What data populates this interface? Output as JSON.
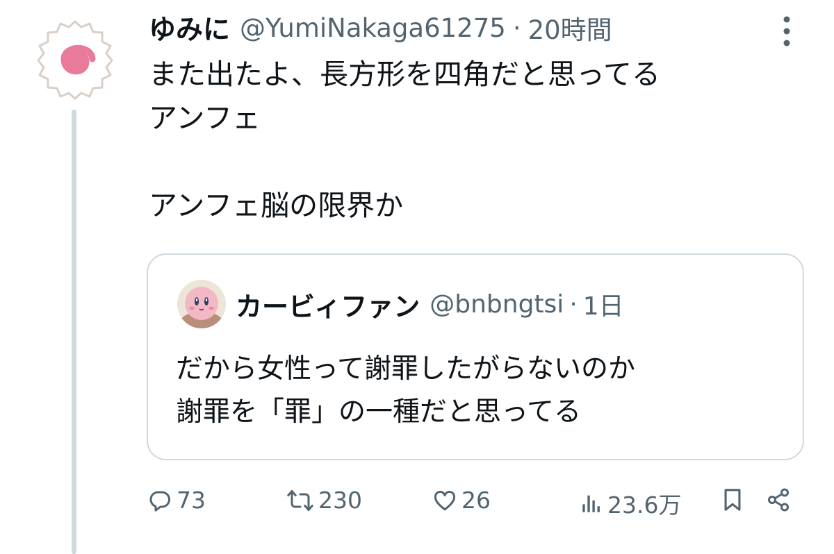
{
  "tweet": {
    "display_name": "ゆみに",
    "handle": "@YumiNakaga61275",
    "separator": "·",
    "time": "20時間",
    "avatar_icon": "naruto-fishcake-icon",
    "text_lines": [
      "また出たよ、長方形を四角だと思ってる",
      "アンフェ",
      "",
      "アンフェ脳の限界か"
    ]
  },
  "quote": {
    "display_name": "カービィファン",
    "handle": "@bnbngtsi",
    "separator": "·",
    "time": "1日",
    "avatar_icon": "kirby-avatar-icon",
    "text_lines": [
      "だから女性って謝罪したがらないのか",
      "謝罪を「罪」の一種だと思ってる"
    ]
  },
  "actions": {
    "replies": "73",
    "retweets": "230",
    "likes": "26",
    "views": "23.6万"
  },
  "colors": {
    "text": "#0f1419",
    "secondary": "#536471",
    "border": "#cfd9de",
    "avatar_pink": "#e87a9a",
    "kirby_pink": "#f2b8c6"
  }
}
